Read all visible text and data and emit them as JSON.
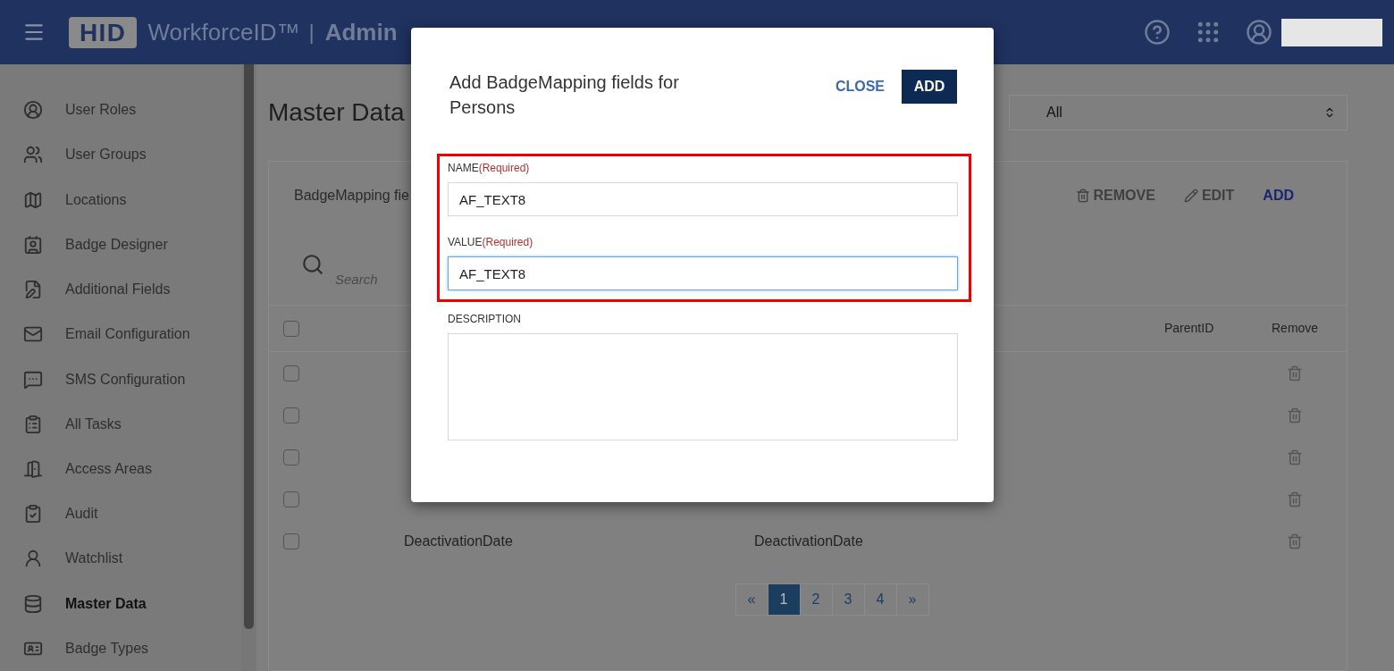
{
  "header": {
    "logo": "HID",
    "product": "WorkforceID™",
    "separator": "|",
    "section": "Admin"
  },
  "sidebar": {
    "items": [
      {
        "label": "User Roles",
        "selected": false
      },
      {
        "label": "User Groups",
        "selected": false
      },
      {
        "label": "Locations",
        "selected": false
      },
      {
        "label": "Badge Designer",
        "selected": false
      },
      {
        "label": "Additional Fields",
        "selected": false
      },
      {
        "label": "Email Configuration",
        "selected": false
      },
      {
        "label": "SMS Configuration",
        "selected": false
      },
      {
        "label": "All Tasks",
        "selected": false
      },
      {
        "label": "Access Areas",
        "selected": false
      },
      {
        "label": "Audit",
        "selected": false
      },
      {
        "label": "Watchlist",
        "selected": false
      },
      {
        "label": "Master Data",
        "selected": true
      },
      {
        "label": "Badge Types",
        "selected": false
      }
    ]
  },
  "page": {
    "title": "Master Data",
    "filter": {
      "value": "All"
    }
  },
  "card": {
    "title": "BadgeMapping fie",
    "actions": [
      {
        "label": "REMOVE",
        "kind": "remove",
        "disabled": true
      },
      {
        "label": "EDIT",
        "kind": "edit",
        "disabled": true
      },
      {
        "label": "ADD",
        "kind": "add",
        "disabled": false
      }
    ],
    "search": {
      "placeholder": "Search"
    },
    "table": {
      "select_all": {
        "checked": false
      },
      "columns": [
        "ParentID",
        "Remove"
      ],
      "rows": [
        {
          "checked": false
        },
        {
          "checked": false
        },
        {
          "checked": false
        },
        {
          "checked": false
        },
        {
          "checked": false,
          "name": "DeactivationDate",
          "value": "DeactivationDate"
        }
      ]
    },
    "pagination": [
      {
        "label": "«",
        "selected": false
      },
      {
        "label": "1",
        "selected": true
      },
      {
        "label": "2",
        "selected": false
      },
      {
        "label": "3",
        "selected": false
      },
      {
        "label": "4",
        "selected": false
      },
      {
        "label": "»",
        "selected": false
      }
    ]
  },
  "dialog": {
    "title": "Add BadgeMapping fields for Persons",
    "close": "CLOSE",
    "add": "ADD",
    "fields": [
      {
        "label": "NAME",
        "required": "(Required)",
        "value": "AF_TEXT8",
        "focused": false,
        "kind": "input"
      },
      {
        "label": "VALUE",
        "required": "(Required)",
        "value": "AF_TEXT8",
        "focused": true,
        "kind": "input"
      },
      {
        "label": "DESCRIPTION",
        "focused": false,
        "kind": "textarea"
      }
    ]
  }
}
